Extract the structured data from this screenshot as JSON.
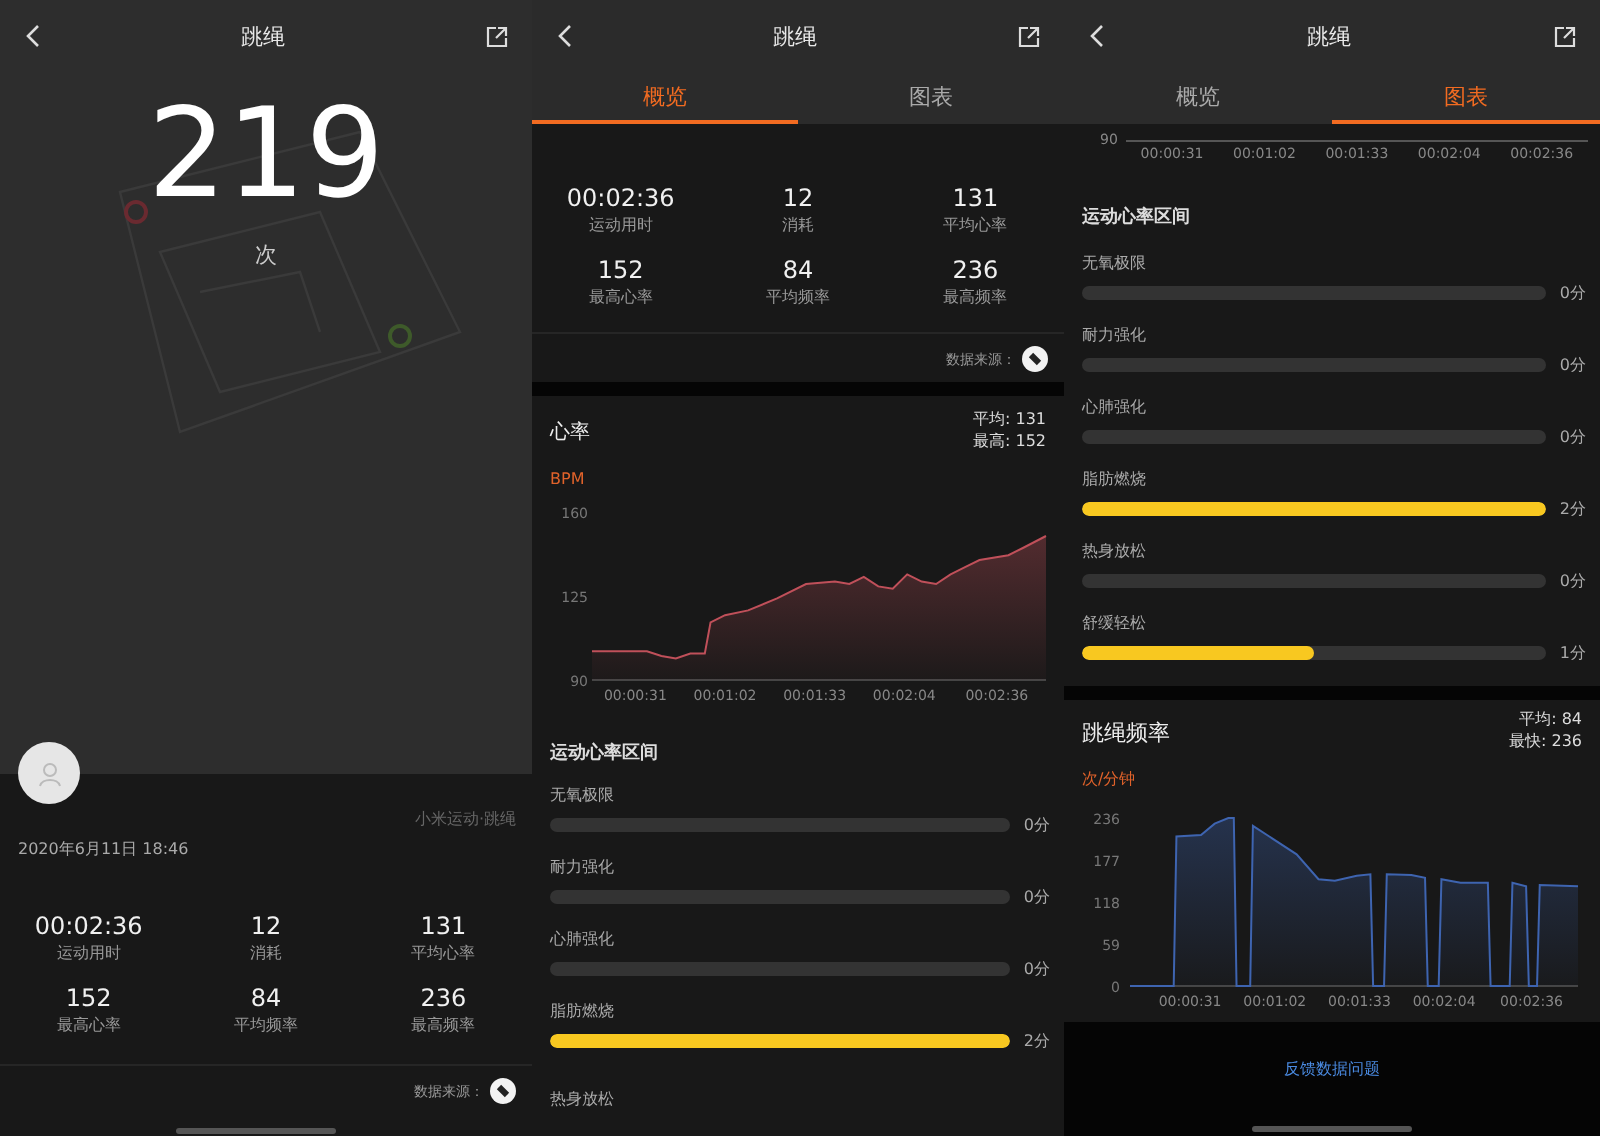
{
  "summary_screen": {
    "header": {
      "title": "跳绳"
    },
    "count": "219",
    "count_unit": "次",
    "app_name": "小米运动·跳绳",
    "date": "2020年6月11日 18:46",
    "stats": [
      {
        "value": "00:02:36",
        "label": "运动用时"
      },
      {
        "value": "12",
        "label": "消耗"
      },
      {
        "value": "131",
        "label": "平均心率"
      },
      {
        "value": "152",
        "label": "最高心率"
      },
      {
        "value": "84",
        "label": "平均频率"
      },
      {
        "value": "236",
        "label": "最高频率"
      }
    ],
    "data_source": "数据来源："
  },
  "overview_screen": {
    "header": {
      "title": "跳绳"
    },
    "tabs": [
      {
        "label": "概览",
        "selected": true
      },
      {
        "label": "图表",
        "selected": false
      }
    ],
    "stats": [
      {
        "value": "00:02:36",
        "label": "运动用时"
      },
      {
        "value": "12",
        "label": "消耗"
      },
      {
        "value": "131",
        "label": "平均心率"
      },
      {
        "value": "152",
        "label": "最高心率"
      },
      {
        "value": "84",
        "label": "平均频率"
      },
      {
        "value": "236",
        "label": "最高频率"
      }
    ],
    "data_source": "数据来源：",
    "heart_rate": {
      "title": "心率",
      "average": "平均: 131",
      "maximum": "最高: 152",
      "unit": "BPM",
      "chart_data": {
        "type": "area",
        "xlim": [
          16,
          173
        ],
        "x": [
          16,
          35,
          40,
          45,
          50,
          55,
          57,
          62,
          70,
          80,
          90,
          100,
          105,
          110,
          115,
          120,
          125,
          130,
          135,
          140,
          145,
          150,
          160,
          165,
          173
        ],
        "series": [
          {
            "color": "#c0505a",
            "values": [
              102,
              102,
              100,
              99,
              101,
              101,
              114,
              117,
              119,
              124,
              130,
              131,
              130,
              133,
              129,
              128,
              134,
              131,
              130,
              134,
              137,
              140,
              142,
              145,
              150
            ]
          }
        ],
        "ylim": [
          90,
          160
        ],
        "yticks": [
          90,
          125,
          160
        ],
        "xticks": [
          {
            "value": 31,
            "label": "00:00:31"
          },
          {
            "value": 62,
            "label": "00:01:02"
          },
          {
            "value": 93,
            "label": "00:01:33"
          },
          {
            "value": 124,
            "label": "00:02:04"
          },
          {
            "value": 156,
            "label": "00:02:36"
          }
        ]
      }
    },
    "zones_title": "运动心率区间",
    "zones": [
      {
        "label": "无氧极限",
        "level": 0,
        "reading": "0分"
      },
      {
        "label": "耐力强化",
        "level": 0,
        "reading": "0分"
      },
      {
        "label": "心肺强化",
        "level": 0,
        "reading": "0分"
      },
      {
        "label": "脂肪燃烧",
        "level": 1,
        "reading": "2分"
      },
      {
        "label": "热身放松"
      }
    ]
  },
  "charts_screen": {
    "header": {
      "title": "跳绳"
    },
    "tabs": [
      {
        "label": "概览",
        "selected": false
      },
      {
        "label": "图表",
        "selected": true
      }
    ],
    "axis_fragment": {
      "y_label": "90",
      "x_labels": [
        "00:00:31",
        "00:01:02",
        "00:01:33",
        "00:02:04",
        "00:02:36"
      ]
    },
    "zones_title": "运动心率区间",
    "zones": [
      {
        "label": "无氧极限",
        "level": 0,
        "reading": "0分"
      },
      {
        "label": "耐力强化",
        "level": 0,
        "reading": "0分"
      },
      {
        "label": "心肺强化",
        "level": 0,
        "reading": "0分"
      },
      {
        "label": "脂肪燃烧",
        "level": 1,
        "reading": "2分"
      },
      {
        "label": "热身放松",
        "level": 0,
        "reading": "0分"
      },
      {
        "label": "舒缓轻松",
        "level": 0.5,
        "reading": "1分"
      }
    ],
    "jump_rate": {
      "title": "跳绳频率",
      "average": "平均: 84",
      "fastest": "最快: 236",
      "unit": "次/分钟",
      "chart_data": {
        "type": "area",
        "xlim": [
          9,
          173
        ],
        "x": [
          9,
          25,
          26,
          35,
          40,
          45,
          47,
          48,
          53,
          54,
          60,
          70,
          78,
          84,
          92,
          97,
          98,
          102,
          103,
          112,
          117,
          118,
          122,
          123,
          130,
          140,
          141,
          148,
          149,
          154,
          155,
          158,
          159,
          173
        ],
        "series": [
          {
            "color": "#3e64b0",
            "values": [
              0,
              0,
              210,
              212,
              228,
              236,
              236,
              0,
              0,
              225,
              210,
              185,
              150,
              148,
              155,
              157,
              0,
              0,
              157,
              156,
              152,
              0,
              0,
              150,
              145,
              145,
              0,
              0,
              145,
              140,
              0,
              0,
              142,
              140
            ]
          }
        ],
        "ylim": [
          0,
          236
        ],
        "yticks": [
          0,
          59,
          118,
          177,
          236
        ],
        "xticks": [
          {
            "value": 31,
            "label": "00:00:31"
          },
          {
            "value": 62,
            "label": "00:01:02"
          },
          {
            "value": 93,
            "label": "00:01:33"
          },
          {
            "value": 124,
            "label": "00:02:04"
          },
          {
            "value": 156,
            "label": "00:02:36"
          }
        ]
      }
    },
    "feedback_link": "反馈数据问题"
  }
}
